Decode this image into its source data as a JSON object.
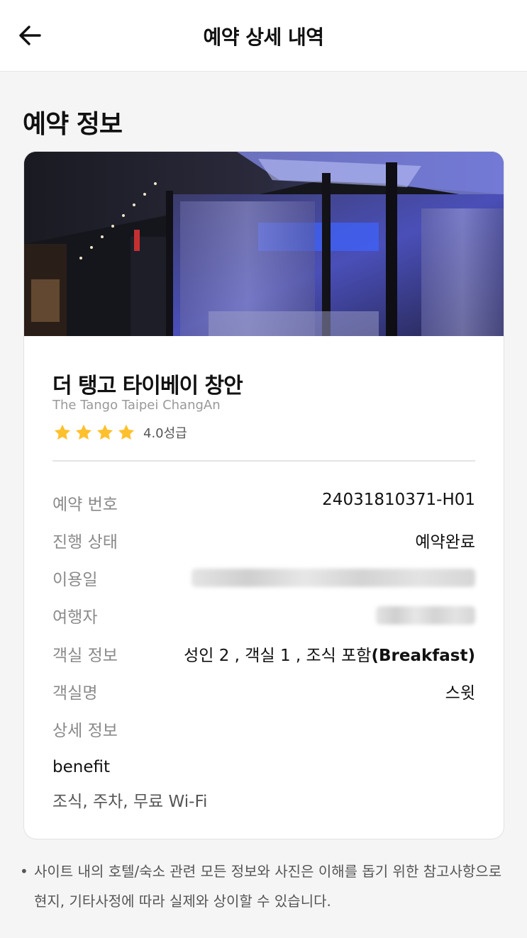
{
  "header": {
    "title": "예약 상세 내역",
    "back_icon": "arrow-left-icon"
  },
  "section": {
    "title": "예약 정보"
  },
  "hotel": {
    "name_ko": "더 탱고 타이베이 창안",
    "name_en": "The Tango Taipei ChangAn",
    "star_count": 4,
    "grade": "4.0성급",
    "star_color": "#ffc02d"
  },
  "details": {
    "reservation_number": {
      "label": "예약 번호",
      "value": "24031810371-H01"
    },
    "status": {
      "label": "진행 상태",
      "value": "예약완료"
    },
    "stay_date": {
      "label": "이용일"
    },
    "traveler": {
      "label": "여행자"
    },
    "room_info": {
      "label": "객실 정보",
      "value_prefix": "성인 2 , 객실 1 , 조식 포함",
      "value_bold": "(Breakfast)"
    },
    "room_name": {
      "label": "객실명",
      "value": "스윗"
    },
    "detail_info": {
      "label": "상세 정보"
    }
  },
  "benefit": {
    "title": "benefit",
    "value": "조식, 주차, 무료 Wi-Fi"
  },
  "notice": {
    "bullet": "•",
    "text": "사이트 내의 호텔/숙소 관련 모든 정보와 사진은 이해를 돕기 위한 참고사항으로 현지, 기타사정에 따라 실제와 상이할 수 있습니다."
  }
}
